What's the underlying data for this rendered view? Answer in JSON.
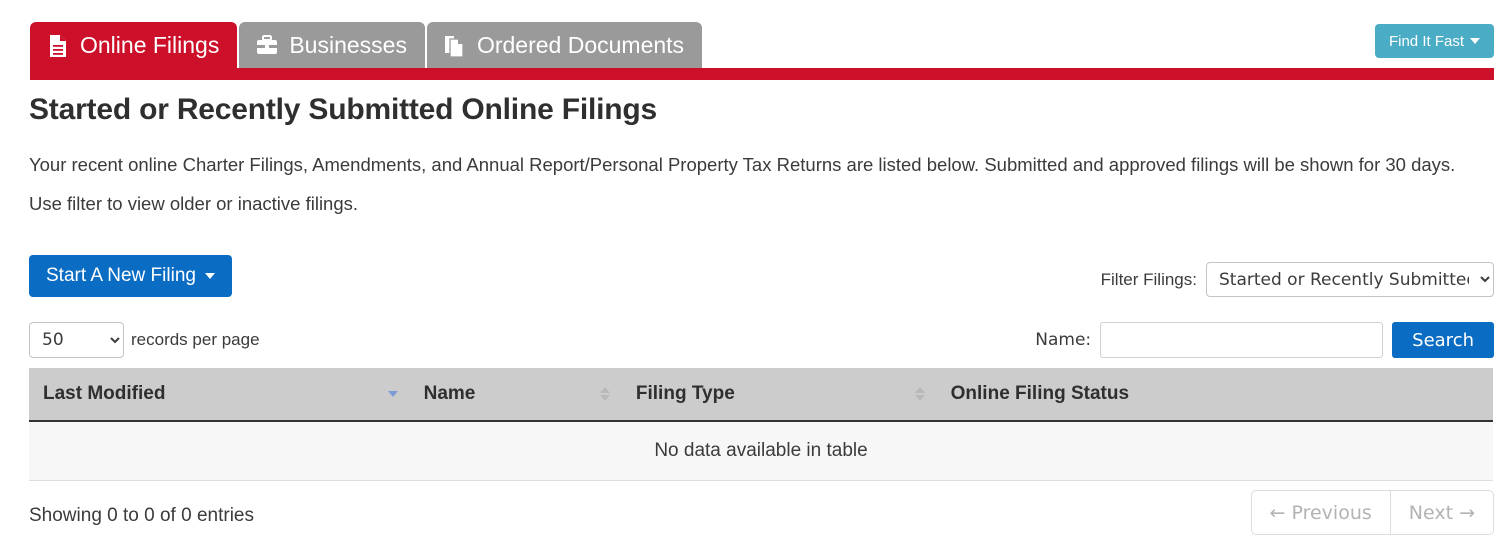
{
  "header": {
    "tabs": [
      {
        "label": "Online Filings",
        "icon": "file-lines-icon",
        "active": true
      },
      {
        "label": "Businesses",
        "icon": "briefcase-icon",
        "active": false
      },
      {
        "label": "Ordered Documents",
        "icon": "copy-documents-icon",
        "active": false
      }
    ],
    "find_it_fast_label": "Find It Fast",
    "accent_red": "#cd1029",
    "tab_inactive_gray": "#9a9a9a",
    "find_it_fast_color": "#4bacc6"
  },
  "page": {
    "title": "Started or Recently Submitted Online Filings",
    "intro": "Your recent online Charter Filings, Amendments, and Annual Report/Personal Property Tax Returns are listed below. Submitted and approved filings will be shown for 30 days. Use filter to view older or inactive filings."
  },
  "controls": {
    "start_filing_label": "Start A New Filing",
    "start_filing_color": "#0b6cc4",
    "filter_label": "Filter Filings:",
    "filter_value": "Started or Recently Submitted",
    "filter_options": [
      "Started or Recently Submitted"
    ]
  },
  "toolbar": {
    "length_value": "50",
    "length_options": [
      "50"
    ],
    "length_label": "records per page",
    "name_label": "Name:",
    "name_value": "",
    "name_placeholder": "",
    "search_label": "Search"
  },
  "table": {
    "columns": [
      {
        "label": "Last Modified",
        "sort": "desc"
      },
      {
        "label": "Name",
        "sort": "none"
      },
      {
        "label": "Filing Type",
        "sort": "none"
      },
      {
        "label": "Online Filing Status",
        "sort": "none"
      }
    ],
    "empty_message": "No data available in table",
    "rows": []
  },
  "footer": {
    "showing": "Showing 0 to 0 of 0 entries",
    "previous_label": "← Previous",
    "next_label": "Next →"
  }
}
